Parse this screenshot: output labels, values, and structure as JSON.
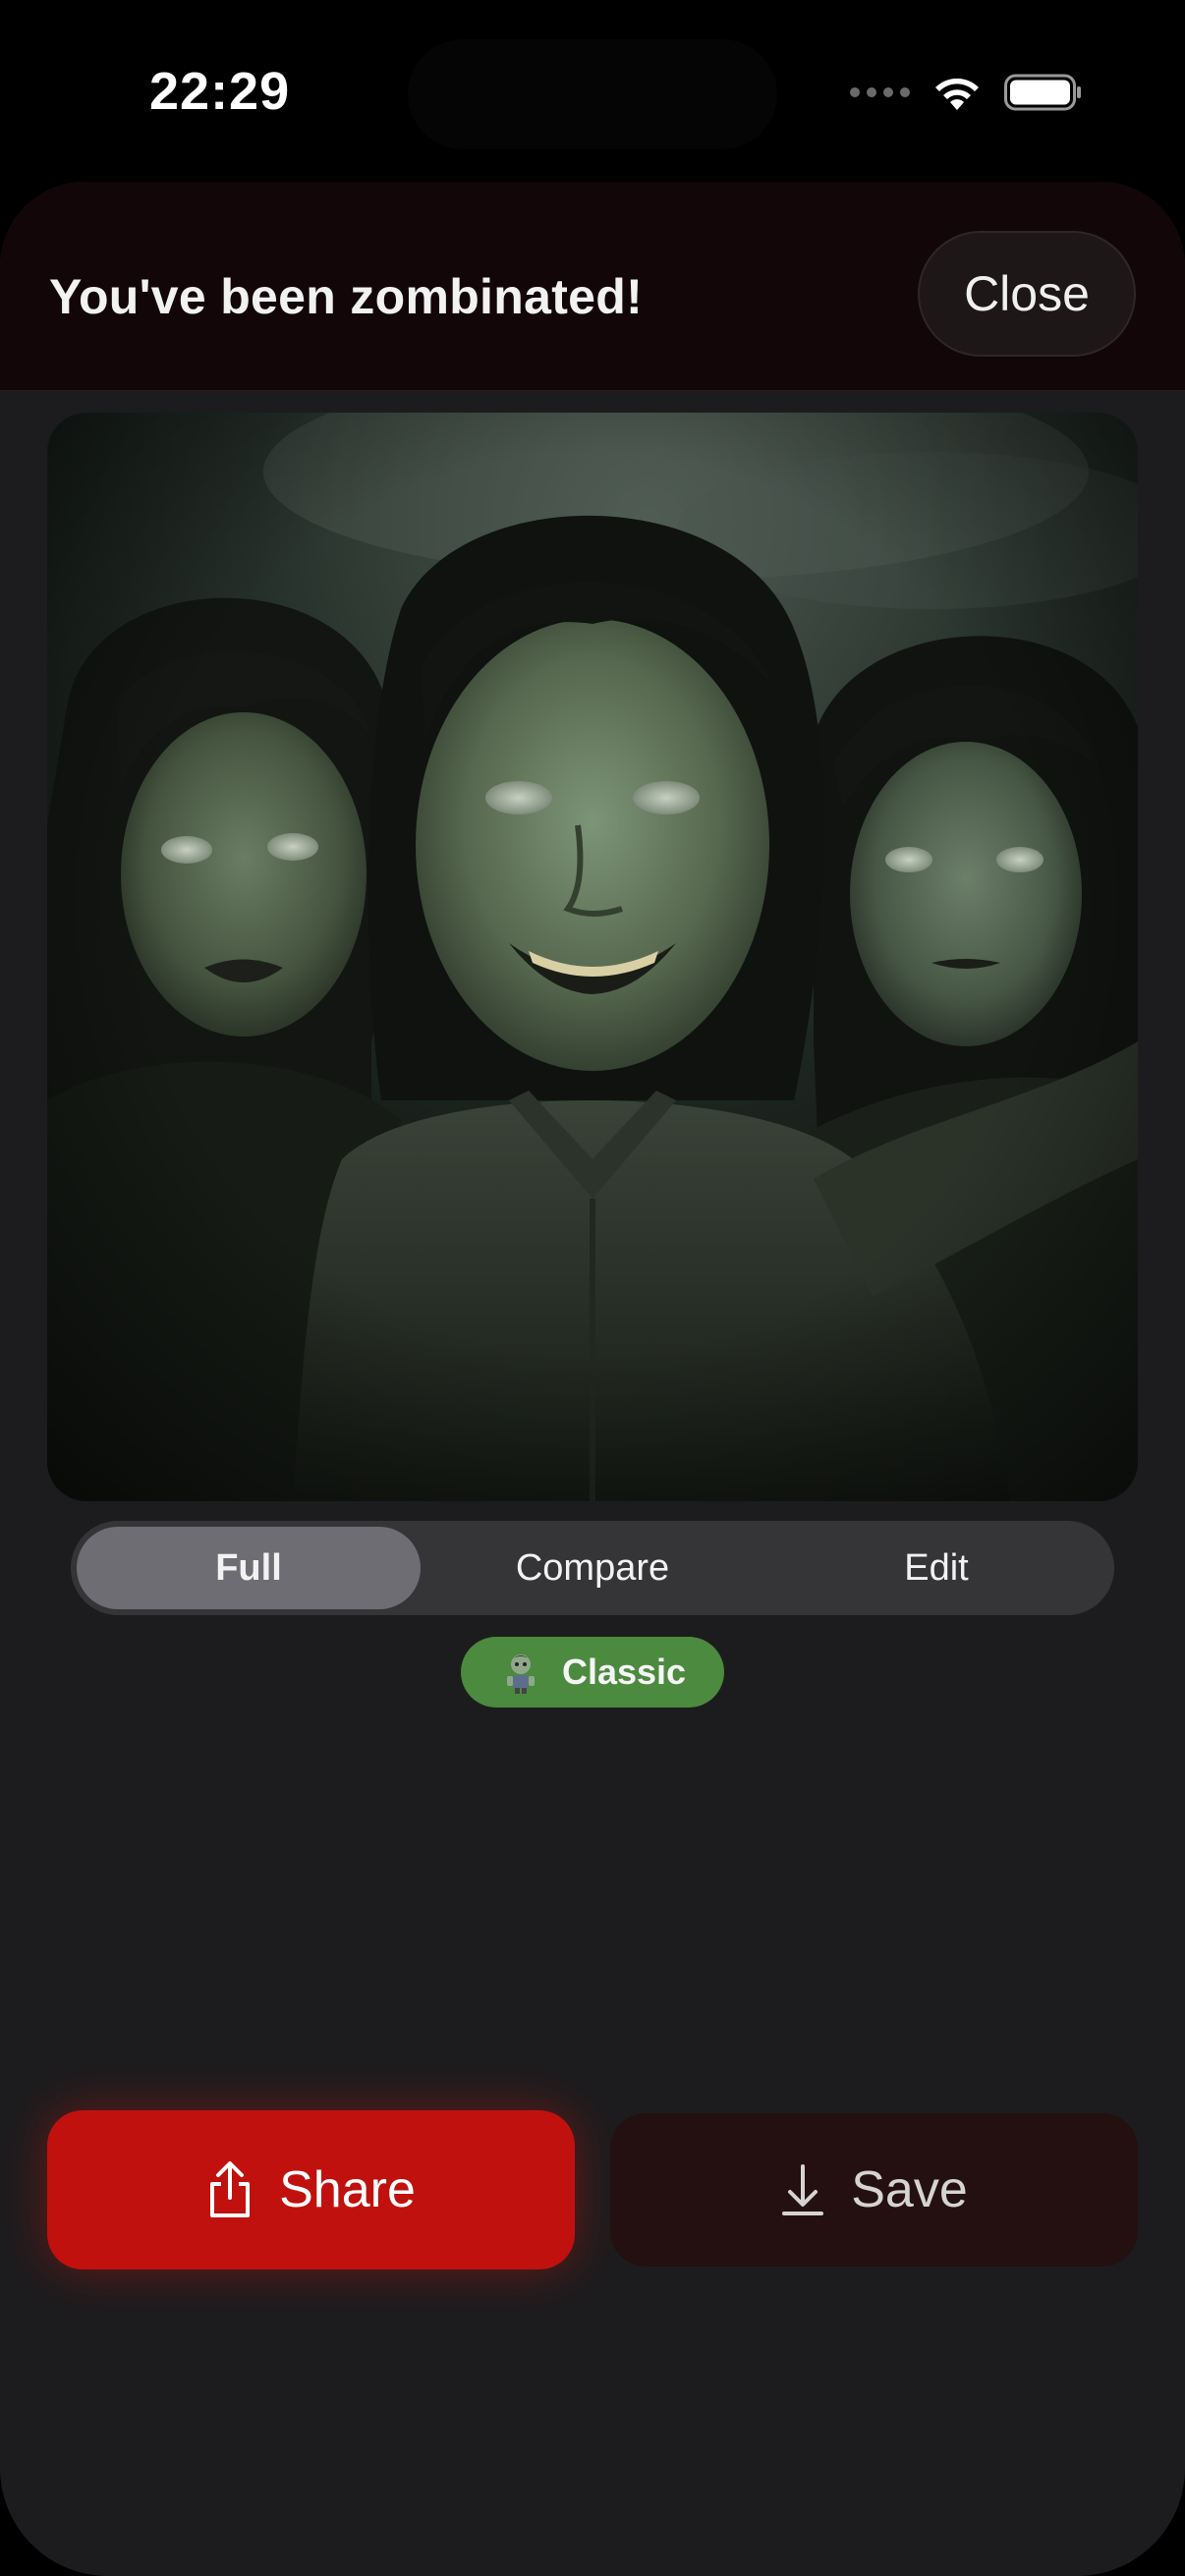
{
  "status_bar": {
    "time": "22:29"
  },
  "header": {
    "title": "You've been zombinated!",
    "close_label": "Close"
  },
  "image": {
    "subject": "three zombie faces in dark, misty green tones",
    "icon": "photo-content"
  },
  "view_modes": {
    "tabs": [
      {
        "label": "Full",
        "selected": true
      },
      {
        "label": "Compare",
        "selected": false
      },
      {
        "label": "Edit",
        "selected": false
      }
    ]
  },
  "style": {
    "label": "Classic",
    "icon": "zombie-icon",
    "color": "#4c8a3f"
  },
  "actions": {
    "share_label": "Share",
    "share_icon": "share-icon",
    "share_color": "#c0110f",
    "save_label": "Save",
    "save_icon": "download-icon",
    "save_color": "#241011"
  }
}
